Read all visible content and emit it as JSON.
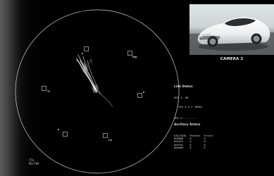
{
  "vectorscope": {
    "targets": [
      {
        "id": "R",
        "label": ""
      },
      {
        "id": "Mg",
        "label": "Mg"
      },
      {
        "id": "B",
        "label": ""
      },
      {
        "id": "Cy",
        "label": "Cy"
      },
      {
        "id": "G",
        "label": ""
      },
      {
        "id": "Yl",
        "label": "Yl"
      }
    ],
    "scale": {
      "line1": "75%",
      "line2": "REC709"
    }
  },
  "camera": {
    "label": "CAMERA 2"
  },
  "link_status": {
    "title": "Link Status",
    "sdi1_label": "SDI 1: HD",
    "sdi1_format": "YUV 4:2:2 1080i",
    "sdi2_label": "SDI 2: -------"
  },
  "ancillary_status": {
    "title": "Ancillary Status",
    "columns": [
      "DID/SDID",
      "Packets",
      "Errors"
    ],
    "rows": [
      [
        "0x0000",
        "0",
        "0"
      ],
      [
        "0x0101",
        "0",
        "0"
      ],
      [
        "0x0101",
        "0",
        "0"
      ],
      [
        "0x0000",
        "0",
        "0"
      ]
    ]
  }
}
